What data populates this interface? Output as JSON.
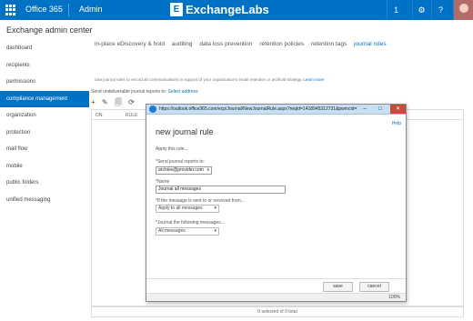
{
  "topbar": {
    "app": "Office 365",
    "section": "Admin",
    "brand": "ExchangeLabs",
    "brand_logo": "E",
    "icons": [
      {
        "name": "notifications-icon",
        "glyph": "1"
      },
      {
        "name": "settings-icon",
        "glyph": "⚙"
      },
      {
        "name": "help-icon",
        "glyph": "?"
      }
    ]
  },
  "page": {
    "title": "Exchange admin center"
  },
  "nav": {
    "items": [
      {
        "label": "dashboard"
      },
      {
        "label": "recipients"
      },
      {
        "label": "permissions"
      },
      {
        "label": "compliance management"
      },
      {
        "label": "organization"
      },
      {
        "label": "protection"
      },
      {
        "label": "mail flow"
      },
      {
        "label": "mobile"
      },
      {
        "label": "public folders"
      },
      {
        "label": "unified messaging"
      }
    ],
    "active_index": 3
  },
  "tabs": [
    {
      "label": "in-place eDiscovery & hold"
    },
    {
      "label": "auditing"
    },
    {
      "label": "data loss prevention"
    },
    {
      "label": "retention policies"
    },
    {
      "label": "retention tags"
    },
    {
      "label": "journal rules"
    }
  ],
  "active_tab": 5,
  "content": {
    "description": "Use journal rules to record all communications in support of your organization's email retention or archival strategy.",
    "learn_more": "Learn more",
    "send_text": "Send undeliverable journal reports to:",
    "send_link": "Select address",
    "toolbar": [
      "+",
      "✎",
      "🗐",
      "⟳"
    ],
    "columns": [
      "ON",
      "RULE"
    ],
    "footer": "0 selected of 0 total"
  },
  "dialog": {
    "url": "https://outlook.office365.com/ecp/Journal/NewJournalRule.aspx?reqId=1418945312731&pwmcid=1&ReturnObjectType=1",
    "help": "Help",
    "heading": "new journal rule",
    "apply_label": "Apply this rule...",
    "send_label": "*Send journal reports to:",
    "send_value": "archive@provider.com",
    "name_label": "*Name",
    "name_value": "Journal all messages",
    "if_label": "*If the message is sent to or received from...",
    "if_value": "Apply to all messages",
    "journal_label": "*Journal the following messages...",
    "journal_value": "All messages",
    "save": "save",
    "cancel": "cancel",
    "zoom": "100%"
  }
}
